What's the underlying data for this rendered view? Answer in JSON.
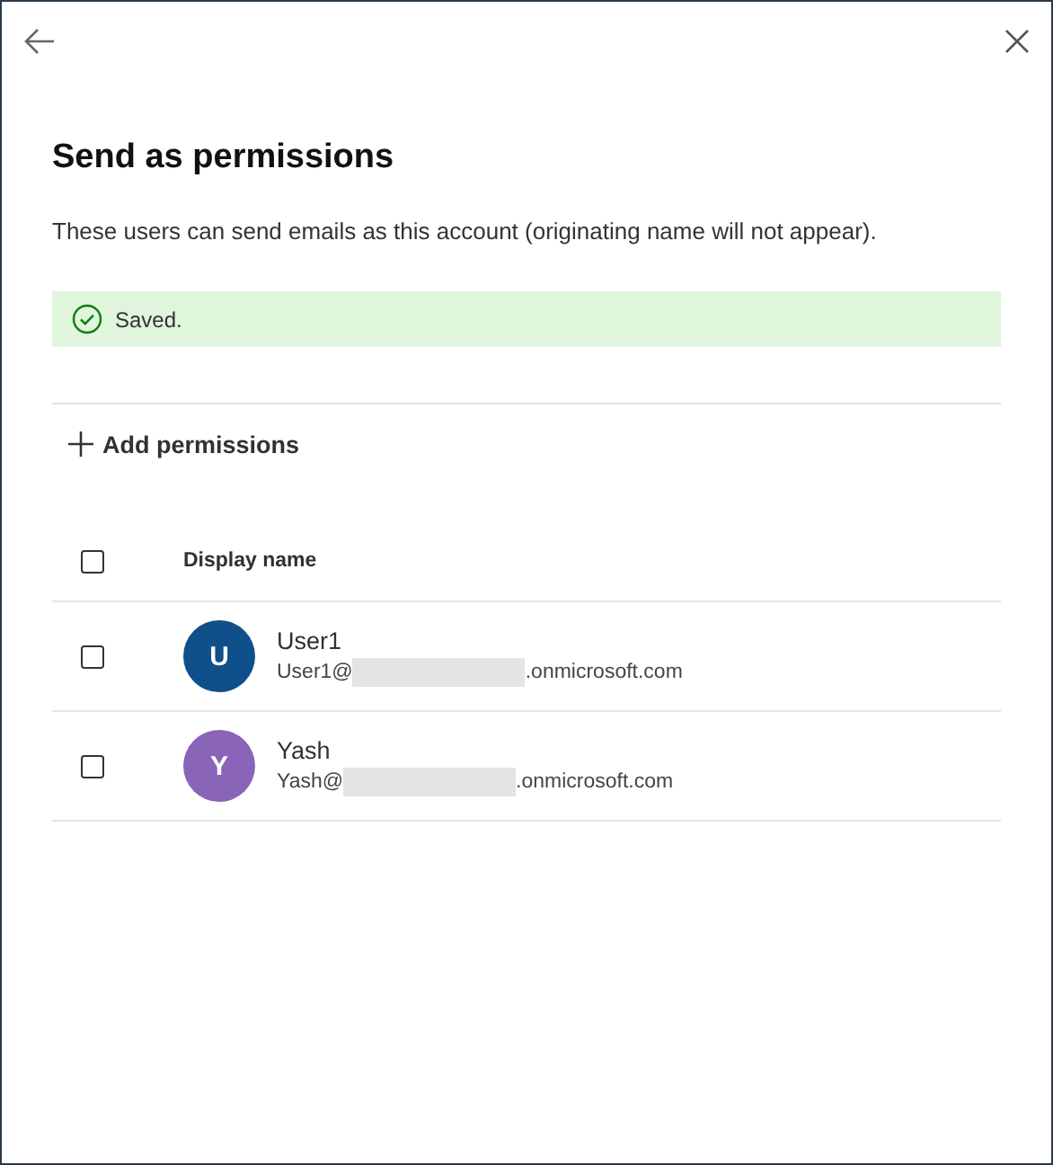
{
  "panel": {
    "title": "Send as permissions",
    "description": "These users can send emails as this account (originating name will not appear).",
    "banner": {
      "kind": "success",
      "message": "Saved."
    },
    "add_button": {
      "label": "Add permissions"
    },
    "table": {
      "select_all_checked": false,
      "columns": [
        "Display name"
      ],
      "rows": [
        {
          "initial": "U",
          "color": "#0f4f8a",
          "name": "User1",
          "email_prefix": "User1@",
          "email_suffix": ".onmicrosoft.com",
          "checked": false
        },
        {
          "initial": "Y",
          "color": "#8a64b8",
          "name": "Yash",
          "email_prefix": "Yash@",
          "email_suffix": ".onmicrosoft.com",
          "checked": false
        }
      ]
    }
  }
}
